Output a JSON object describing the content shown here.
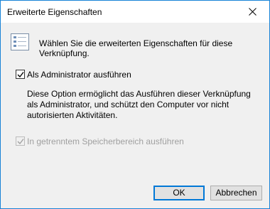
{
  "window": {
    "title": "Erweiterte Eigenschaften",
    "close_icon": "close-icon"
  },
  "header": {
    "icon": "checklist-icon",
    "text": "Wählen Sie die erweiterten Eigenschaften für diese Verknüpfung."
  },
  "run_as_admin": {
    "label": "Als Administrator ausführen",
    "checked": true,
    "enabled": true,
    "description": "Diese Option ermöglicht das Ausführen dieser Verknüpfung als Administrator, und schützt den Computer vor nicht autorisierten Aktivitäten."
  },
  "separate_memory": {
    "label": "In getrenntem Speicherbereich ausführen",
    "checked": true,
    "enabled": false
  },
  "buttons": {
    "ok": "OK",
    "cancel": "Abbrechen"
  },
  "colors": {
    "window_border": "#1883d7",
    "dialog_bg": "#f0f0f0",
    "default_button_border": "#0078d7",
    "disabled_text": "#a0a0a0"
  }
}
